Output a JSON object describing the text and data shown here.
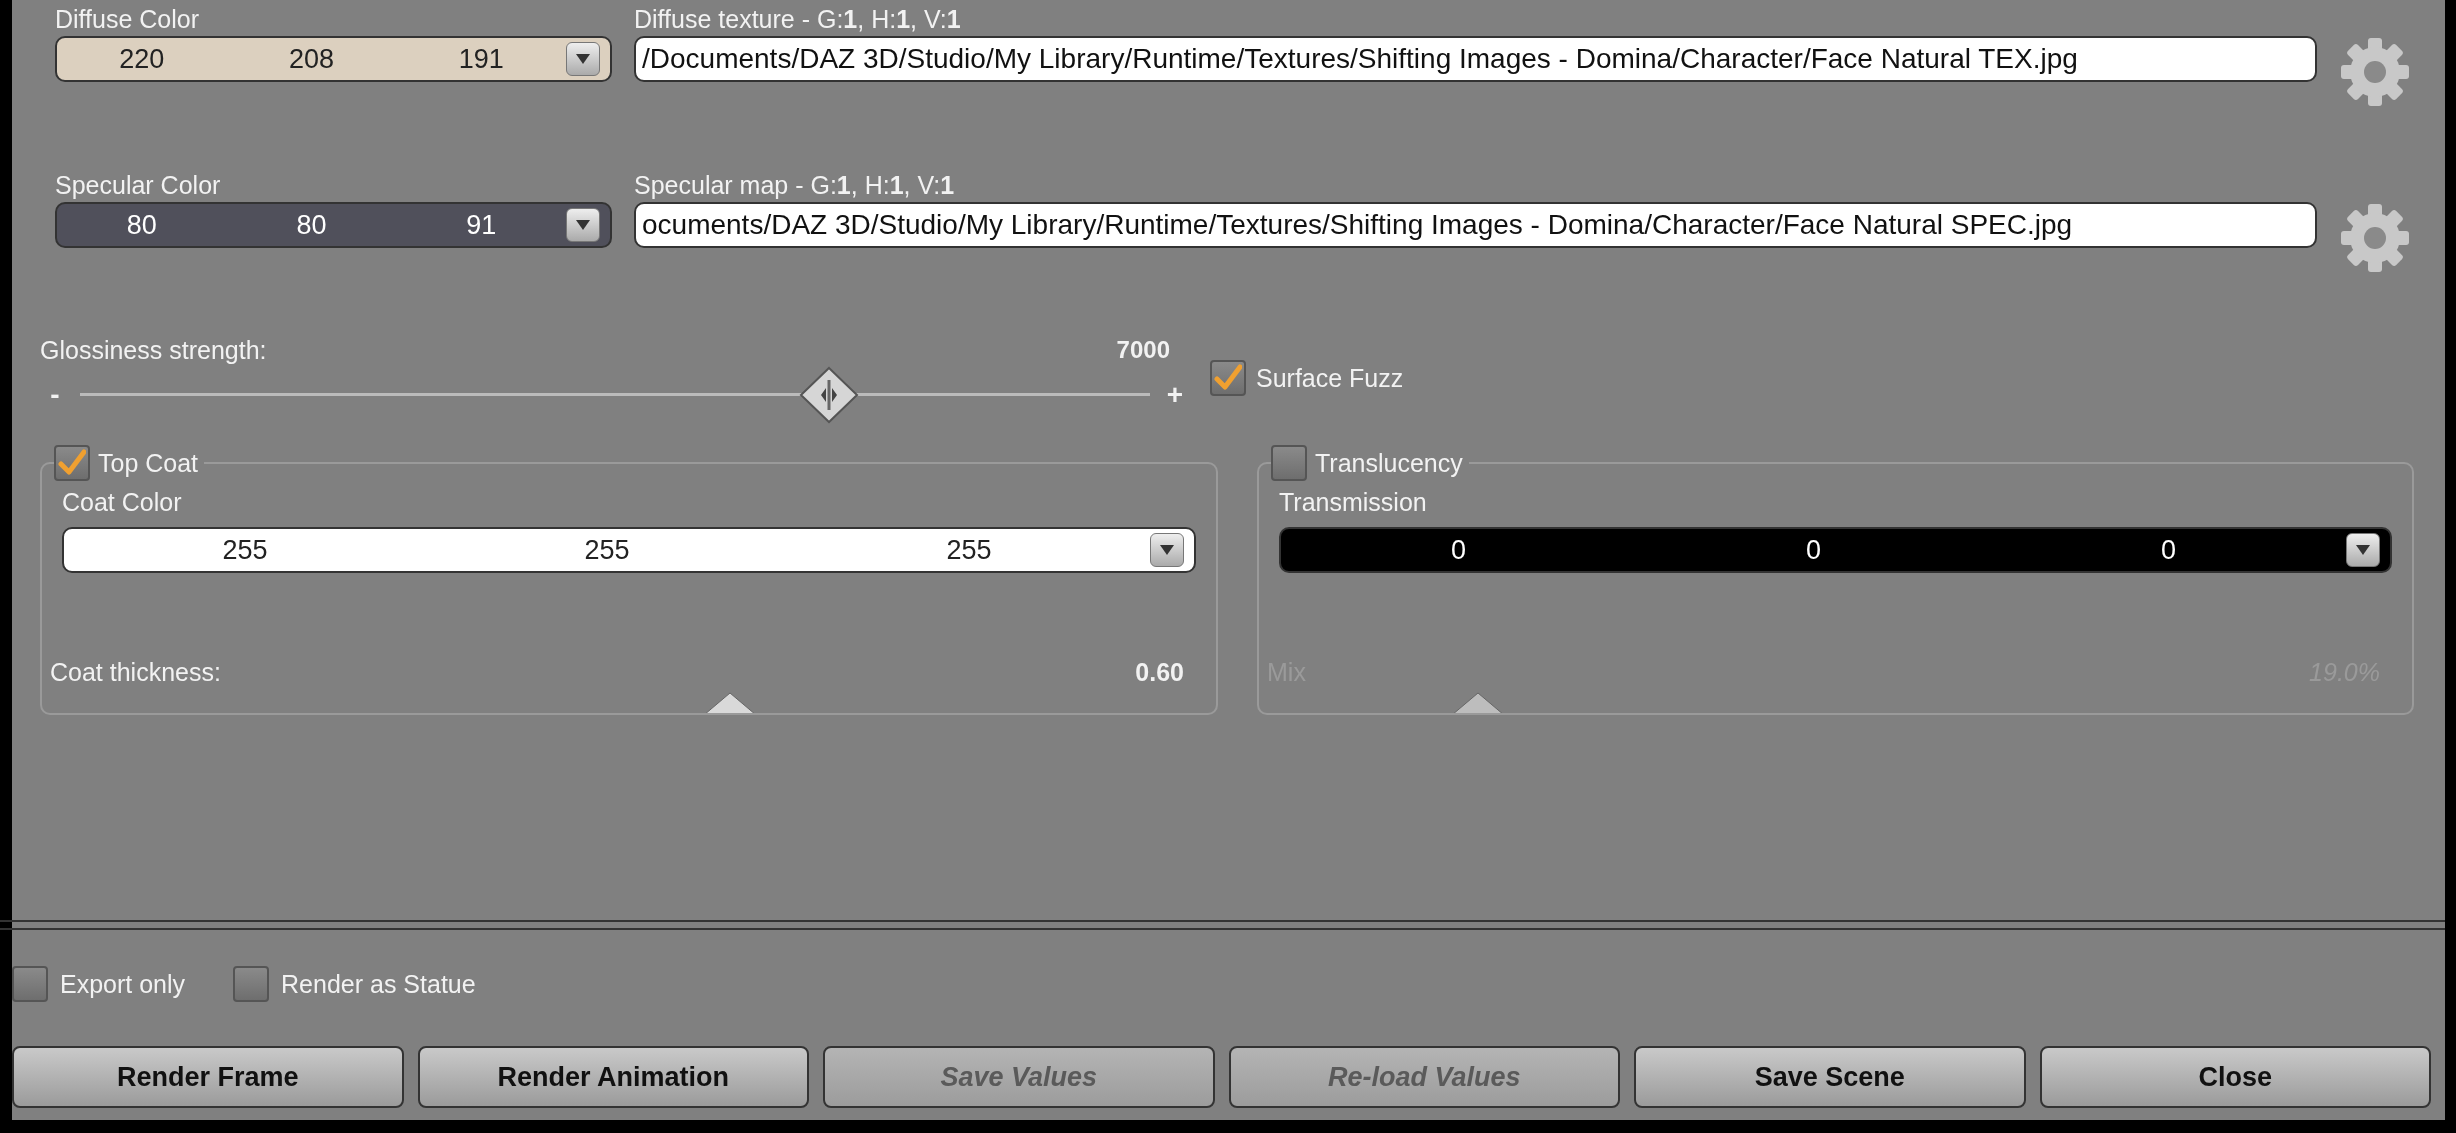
{
  "maps": [
    {
      "color_label": "Diffuse Color",
      "color_values": [
        "220",
        "208",
        "191"
      ],
      "color": "#dcd0bf",
      "map_label": "Diffuse texture - G:**1**, H:**1**, V:**1**",
      "path": "/Documents/DAZ 3D/Studio/My Library/Runtime/Textures/Shifting Images - Domina/Character/Face Natural TEX.jpg"
    },
    {
      "color_label": "Specular Color",
      "color_values": [
        "80",
        "80",
        "91"
      ],
      "color": "#50505b",
      "map_label": "Specular map - G:**1**, H:**1**, V:**1**",
      "path": "ocuments/DAZ 3D/Studio/My Library/Runtime/Textures/Shifting Images - Domina/Character/Face Natural SPEC.jpg"
    }
  ],
  "glossiness": {
    "label": "Glossiness strength:",
    "value": "7000",
    "min_sign": "-",
    "max_sign": "+"
  },
  "surface_fuzz": {
    "label": "Surface Fuzz",
    "checked": true
  },
  "groups": [
    {
      "label": "Top Coat",
      "checked": true,
      "color_label": "Coat Color",
      "color_values": [
        "255",
        "255",
        "255"
      ],
      "color": "#ffffff",
      "slider": {
        "label": "Coat thickness:",
        "value": "0.60",
        "level": 0.6,
        "disabled": false
      }
    },
    {
      "label": "Translucency",
      "checked": false,
      "color_label": "Transmission",
      "color_values": [
        "0",
        "0",
        "0"
      ],
      "color": "#000000",
      "slider": {
        "label": "Mix",
        "value": "19.0%",
        "level": 0.19,
        "disabled": true
      }
    }
  ],
  "options": [
    {
      "label": "Export only",
      "checked": false
    },
    {
      "label": "Render as Statue",
      "checked": false
    }
  ],
  "buttons": [
    {
      "label": "Render Frame",
      "disabled": false
    },
    {
      "label": "Render Animation",
      "disabled": false
    },
    {
      "label": "Save Values",
      "disabled": true
    },
    {
      "label": "Re-load Values",
      "disabled": true
    },
    {
      "label": "Save Scene",
      "disabled": false
    },
    {
      "label": "Close",
      "disabled": false
    }
  ]
}
